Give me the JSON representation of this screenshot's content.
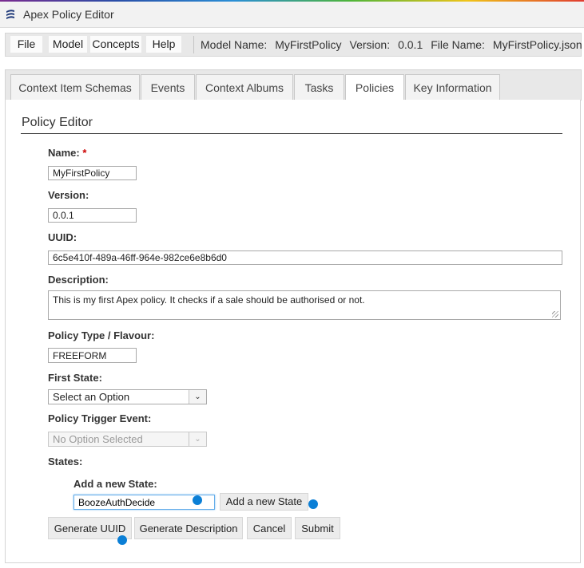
{
  "app": {
    "title": "Apex Policy Editor"
  },
  "menu": {
    "items": [
      {
        "label": "File"
      },
      {
        "label": "Model"
      },
      {
        "label": "Concepts"
      },
      {
        "label": "Help"
      }
    ]
  },
  "model_info": {
    "model_name_label": "Model Name:",
    "model_name_value": "MyFirstPolicy",
    "version_label": "Version:",
    "version_value": "0.0.1",
    "file_name_label": "File Name:",
    "file_name_value": "MyFirstPolicy.json"
  },
  "tabs": [
    {
      "label": "Context Item Schemas"
    },
    {
      "label": "Events"
    },
    {
      "label": "Context Albums"
    },
    {
      "label": "Tasks"
    },
    {
      "label": "Policies",
      "active": true
    },
    {
      "label": "Key Information"
    }
  ],
  "editor": {
    "title": "Policy Editor",
    "name_label": "Name:",
    "required_mark": "*",
    "name_value": "MyFirstPolicy",
    "version_label": "Version:",
    "version_value": "0.0.1",
    "uuid_label": "UUID:",
    "uuid_value": "6c5e410f-489a-46ff-964e-982ce6e8b6d0",
    "description_label": "Description:",
    "description_value": "This is my first Apex policy. It checks if a sale should be authorised or not.",
    "policy_type_label": "Policy Type / Flavour:",
    "policy_type_value": "FREEFORM",
    "first_state_label": "First State:",
    "first_state_value": "Select an Option",
    "trigger_event_label": "Policy Trigger Event:",
    "trigger_event_value": "No Option Selected",
    "states_label": "States:",
    "add_state_label": "Add a new State:",
    "add_state_value": "BoozeAuthDecide",
    "add_state_button": "Add a new State",
    "generate_uuid_button": "Generate UUID",
    "generate_description_button": "Generate Description",
    "cancel_button": "Cancel",
    "submit_button": "Submit"
  },
  "colors": {
    "marker": "#0b7fd6",
    "focus_border": "#66aeea",
    "required": "#cc0000"
  }
}
